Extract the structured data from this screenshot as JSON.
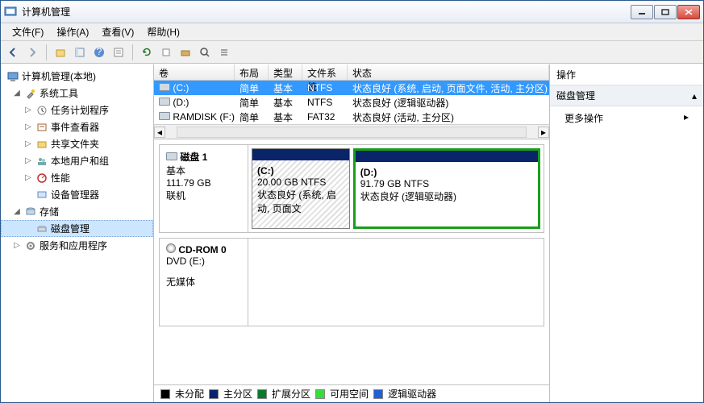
{
  "window": {
    "title": "计算机管理"
  },
  "menu": {
    "file": "文件(F)",
    "action": "操作(A)",
    "view": "查看(V)",
    "help": "帮助(H)"
  },
  "tree": {
    "root": "计算机管理(本地)",
    "systools": "系统工具",
    "tasksched": "任务计划程序",
    "eventvwr": "事件查看器",
    "shared": "共享文件夹",
    "localusers": "本地用户和组",
    "perf": "性能",
    "devmgr": "设备管理器",
    "storage": "存储",
    "diskmgmt": "磁盘管理",
    "services": "服务和应用程序"
  },
  "vol_headers": {
    "vol": "卷",
    "layout": "布局",
    "type": "类型",
    "fs": "文件系统",
    "status": "状态"
  },
  "volumes": [
    {
      "name": "(C:)",
      "layout": "简单",
      "type": "基本",
      "fs": "NTFS",
      "status": "状态良好 (系统, 启动, 页面文件, 活动, 主分区)"
    },
    {
      "name": "(D:)",
      "layout": "简单",
      "type": "基本",
      "fs": "NTFS",
      "status": "状态良好 (逻辑驱动器)"
    },
    {
      "name": "RAMDISK (F:)",
      "layout": "简单",
      "type": "基本",
      "fs": "FAT32",
      "status": "状态良好 (活动, 主分区)"
    }
  ],
  "disk1": {
    "name": "磁盘 1",
    "type": "基本",
    "size": "111.79 GB",
    "state": "联机",
    "c_label": "(C:)",
    "c_size": "20.00 GB NTFS",
    "c_status": "状态良好 (系统, 启动, 页面文",
    "d_label": "(D:)",
    "d_size": "91.79 GB NTFS",
    "d_status": "状态良好 (逻辑驱动器)"
  },
  "cdrom": {
    "name": "CD-ROM 0",
    "sub": "DVD (E:)",
    "state": "无媒体"
  },
  "legend": {
    "unalloc": "未分配",
    "primary": "主分区",
    "ext": "扩展分区",
    "free": "可用空间",
    "logical": "逻辑驱动器"
  },
  "actions": {
    "header": "操作",
    "group": "磁盘管理",
    "more": "更多操作"
  }
}
